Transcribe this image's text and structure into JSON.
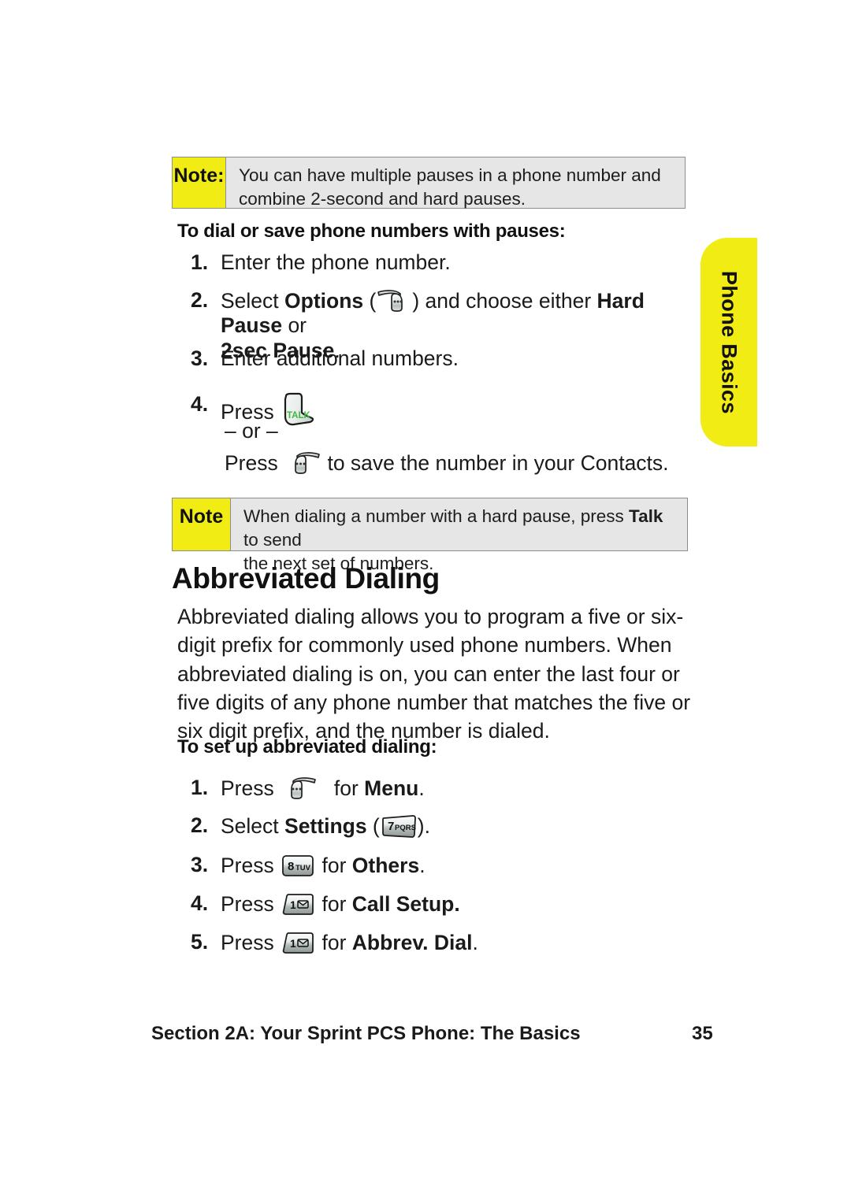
{
  "page": {
    "side_tab_label": "Phone Basics",
    "side_tab_color": "#F2EC15",
    "note_tag_color": "#F2EC15",
    "note_body_color": "#E6E6E6",
    "talk_label_color": "#3DBB3D"
  },
  "note1": {
    "tag": "Note:",
    "body_line1": "You can have multiple pauses in a phone number and",
    "body_line2": "combine 2-second and hard pauses."
  },
  "procedure1": {
    "heading": "To dial or save phone numbers with pauses:",
    "steps": [
      {
        "num": "1.",
        "pre": "Enter the phone number.",
        "icon": "",
        "post": ""
      },
      {
        "num": "2.",
        "pre": "Select ",
        "bold1": "Options",
        "paren_open": " (",
        "icon": "right-softkey",
        "paren_close": ") and choose either ",
        "bold2": "Hard Pause",
        "post": " or",
        "line2_bold": "2sec Pause",
        "line2_post": "."
      },
      {
        "num": "3.",
        "pre": "Enter additional numbers.",
        "icon": "",
        "post": ""
      },
      {
        "num": "4.",
        "pre": "Press ",
        "icon": "talk-key",
        "post": ""
      }
    ],
    "or_divider": "– or –",
    "alt_pre": "Press ",
    "alt_icon": "left-softkey",
    "alt_post": " to save the number in your Contacts."
  },
  "note2": {
    "tag": "Note",
    "body_pre": "When dialing a number with a hard pause, press ",
    "body_bold": "Talk",
    "body_post": " to send",
    "body_line2": "the next set of numbers."
  },
  "section": {
    "title": "Abbreviated Dialing",
    "paragraph": "Abbreviated dialing allows you to program a five or six-digit prefix for commonly used phone numbers. When abbreviated dialing is on, you can enter the last four or five digits of any phone number that matches the five or six digit prefix, and the number is dialed."
  },
  "procedure2": {
    "heading": "To set up abbreviated dialing:",
    "steps": [
      {
        "num": "1.",
        "pre": "Press ",
        "icon": "left-softkey",
        "mid": " for ",
        "bold": "Menu",
        "post": "."
      },
      {
        "num": "2.",
        "pre": "Select ",
        "bold_lead": "Settings",
        "mid": " (",
        "icon": "key-7-pqrs",
        "post": ")."
      },
      {
        "num": "3.",
        "pre": "Press ",
        "icon": "key-8-tuv",
        "mid": " for ",
        "bold": "Others",
        "post": "."
      },
      {
        "num": "4.",
        "pre": "Press ",
        "icon": "key-1-voicemail",
        "mid": " for ",
        "bold": "Call Setup.",
        "post": ""
      },
      {
        "num": "5.",
        "pre": "Press ",
        "icon": "key-1-voicemail",
        "mid": " for ",
        "bold": "Abbrev. Dial",
        "post": "."
      }
    ]
  },
  "keys": {
    "key7_digit": "7",
    "key7_letters": "PQRS",
    "key8_digit": "8",
    "key8_letters": "TUV",
    "key1_digit": "1",
    "talk_label": "TALK"
  },
  "footer": {
    "section_text": "Section 2A: Your Sprint PCS Phone: The Basics",
    "page_number": "35"
  }
}
